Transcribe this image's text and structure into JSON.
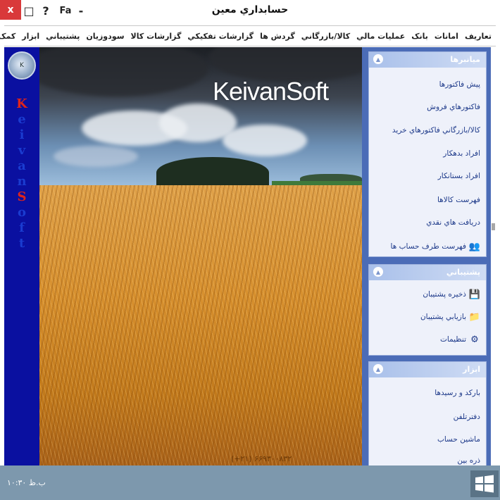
{
  "window": {
    "title": "حسابداري معين",
    "controls": {
      "close": "x",
      "maximize": "□",
      "help": "?",
      "lang": "Fa",
      "minimize": "-"
    }
  },
  "menu": [
    "تعاريف",
    "امانات",
    "بانک",
    "عمليات مالي",
    "کالا/بازرگاني",
    "گردش ها",
    "گزارشات تفکيکي",
    "گزارشات کالا",
    "سودوزيان",
    "پشتيباني",
    "ابزار",
    "کمک"
  ],
  "sidebar_strip": {
    "letters": [
      "K",
      "e",
      "i",
      "v",
      "a",
      "n",
      "S",
      "o",
      "f",
      "t"
    ],
    "logo_letter": "K"
  },
  "banner": {
    "brand": "KeivanSoft",
    "phone": "(+۲۱) ۶۶۹۳۰۰۸۳۲"
  },
  "panels": {
    "shortcuts": {
      "title": "ميانبرها",
      "items": [
        "پيش فاکتورها",
        "فاکتورهاي فروش",
        "کالا/بازرگاني فاکتورهاي خريد",
        "افراد بدهکار",
        "افراد بستانکار",
        "فهرست کالاها",
        "دريافت هاي نقدي",
        "فهرست طرف حساب ها"
      ]
    },
    "backup": {
      "title": "پشتيباني",
      "items": [
        "ذخيره پشتيبان",
        "بازيابي پشتيبان",
        "تنظيمات"
      ]
    },
    "tools": {
      "title": "ابزار",
      "items": [
        "بارکد و رسيدها",
        "دفترتلفن",
        "ماشين حساب",
        "ذره بين"
      ]
    }
  },
  "status": {
    "text": "ب.ظ ۱۰:۳۰"
  },
  "colors": {
    "strip": "#0a10a0",
    "sidebar": "#4b6cb7",
    "status": "#7d98ad",
    "close": "#d9393a"
  }
}
